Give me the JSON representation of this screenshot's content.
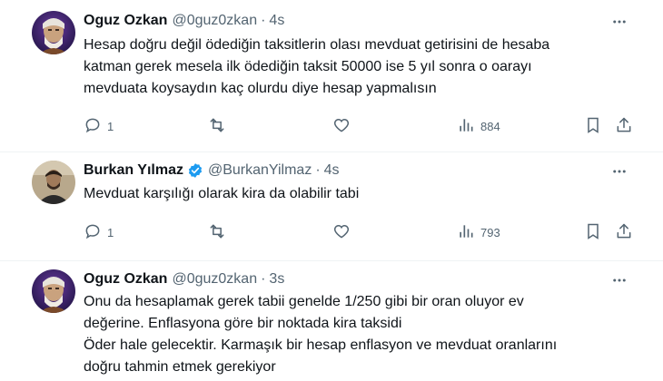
{
  "tweets": [
    {
      "name": "Oguz Ozkan",
      "handle": "@0guz0zkan",
      "dot": "·",
      "time": "4s",
      "lines": [
        "Hesap doğru değil ödediğin taksitlerin olası mevduat getirisini de hesaba",
        "katman gerek mesela ilk ödediğin taksit 50000 ise 5 yıl sonra o oarayı",
        "mevduata koysaydın kaç olurdu diye hesap yapmalısın"
      ],
      "reply_count": "1",
      "views": "884"
    },
    {
      "name": "Burkan Yılmaz",
      "handle": "@BurkanYilmaz",
      "dot": "·",
      "time": "4s",
      "lines": [
        "Mevduat karşılığı olarak kira da olabilir tabi"
      ],
      "reply_count": "1",
      "views": "793"
    },
    {
      "name": "Oguz Ozkan",
      "handle": "@0guz0zkan",
      "dot": "·",
      "time": "3s",
      "lines": [
        "Onu da hesaplamak gerek tabii genelde 1/250 gibi bir oran oluyor ev",
        "değerine. Enflasyona göre bir noktada kira taksidi",
        "Öder hale gelecektir. Karmaşık bir hesap enflasyon ve mevduat oranlarını",
        "doğru tahmin etmek gerekiyor"
      ]
    }
  ],
  "colors": {
    "text": "#0f1419",
    "muted": "#536471",
    "verified": "#1d9bf0",
    "divider": "#eff3f4"
  },
  "icons": [
    "reply-icon",
    "retweet-icon",
    "like-icon",
    "views-icon",
    "bookmark-icon",
    "share-icon",
    "more-icon",
    "verified-badge-icon"
  ]
}
